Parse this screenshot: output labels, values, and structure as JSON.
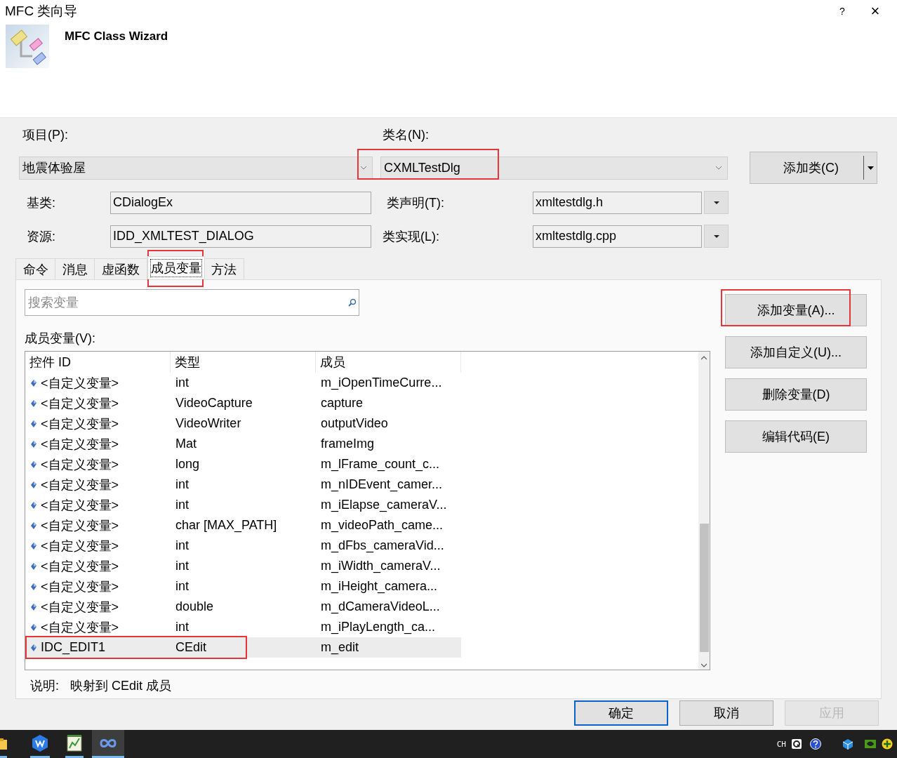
{
  "window": {
    "title": "MFC 类向导",
    "help": "?",
    "close": "×"
  },
  "header": {
    "title": "MFC Class Wizard"
  },
  "project": {
    "label": "项目(P):",
    "value": "地震体验屋"
  },
  "class_name": {
    "label": "类名(N):",
    "value": "CXMLTestDlg",
    "highlighted": true
  },
  "add_class_button": {
    "label": "添加类(C)"
  },
  "base_class": {
    "label": "基类:",
    "value": "CDialogEx"
  },
  "class_declaration": {
    "label": "类声明(T):",
    "value": "xmltestdlg.h"
  },
  "resource": {
    "label": "资源:",
    "value": "IDD_XMLTEST_DIALOG"
  },
  "class_implementation": {
    "label": "类实现(L):",
    "value": "xmltestdlg.cpp"
  },
  "tabs": [
    {
      "label": "命令",
      "selected": false,
      "highlighted": false
    },
    {
      "label": "消息",
      "selected": false,
      "highlighted": false
    },
    {
      "label": "虚函数",
      "selected": false,
      "highlighted": false
    },
    {
      "label": "成员变量",
      "selected": true,
      "highlighted": true
    },
    {
      "label": "方法",
      "selected": false,
      "highlighted": false
    }
  ],
  "search": {
    "placeholder": "搜索变量"
  },
  "members": {
    "label": "成员变量(V):",
    "columns": [
      "控件 ID",
      "类型",
      "成员"
    ],
    "rows": [
      {
        "id": "<自定义变量>",
        "type": "int",
        "member": "m_iOpenTimeCurre...",
        "selected": false,
        "highlighted": false
      },
      {
        "id": "<自定义变量>",
        "type": "VideoCapture",
        "member": "capture",
        "selected": false,
        "highlighted": false
      },
      {
        "id": "<自定义变量>",
        "type": "VideoWriter",
        "member": "outputVideo",
        "selected": false,
        "highlighted": false
      },
      {
        "id": "<自定义变量>",
        "type": "Mat",
        "member": "frameImg",
        "selected": false,
        "highlighted": false
      },
      {
        "id": "<自定义变量>",
        "type": "long",
        "member": "m_lFrame_count_c...",
        "selected": false,
        "highlighted": false
      },
      {
        "id": "<自定义变量>",
        "type": "int",
        "member": "m_nIDEvent_camer...",
        "selected": false,
        "highlighted": false
      },
      {
        "id": "<自定义变量>",
        "type": "int",
        "member": "m_iElapse_cameraV...",
        "selected": false,
        "highlighted": false
      },
      {
        "id": "<自定义变量>",
        "type": "char [MAX_PATH]",
        "member": "m_videoPath_came...",
        "selected": false,
        "highlighted": false
      },
      {
        "id": "<自定义变量>",
        "type": "int",
        "member": "m_dFbs_cameraVid...",
        "selected": false,
        "highlighted": false
      },
      {
        "id": "<自定义变量>",
        "type": "int",
        "member": "m_iWidth_cameraV...",
        "selected": false,
        "highlighted": false
      },
      {
        "id": "<自定义变量>",
        "type": "int",
        "member": "m_iHeight_camera...",
        "selected": false,
        "highlighted": false
      },
      {
        "id": "<自定义变量>",
        "type": "double",
        "member": "m_dCameraVideoL...",
        "selected": false,
        "highlighted": false
      },
      {
        "id": "<自定义变量>",
        "type": "int",
        "member": "m_iPlayLength_ca...",
        "selected": false,
        "highlighted": false
      },
      {
        "id": "IDC_EDIT1",
        "type": "CEdit",
        "member": "m_edit",
        "selected": true,
        "highlighted": true
      }
    ]
  },
  "side_buttons": [
    {
      "label": "添加变量(A)...",
      "highlighted": true
    },
    {
      "label": "添加自定义(U)...",
      "highlighted": false
    },
    {
      "label": "删除变量(D)",
      "highlighted": false
    },
    {
      "label": "编辑代码(E)",
      "highlighted": false
    }
  ],
  "description": {
    "label": "说明:",
    "text": "映射到 CEdit 成员"
  },
  "dialog_buttons": [
    {
      "label": "确定",
      "default": true,
      "disabled": false
    },
    {
      "label": "取消",
      "default": false,
      "disabled": false
    },
    {
      "label": "应用",
      "default": false,
      "disabled": true
    }
  ],
  "taskbar": {
    "apps": [
      {
        "kind": "folder",
        "selected": false
      },
      {
        "kind": "office",
        "selected": false
      },
      {
        "kind": "notepad",
        "selected": false
      },
      {
        "kind": "studio",
        "selected": true
      }
    ],
    "language": "CH"
  }
}
